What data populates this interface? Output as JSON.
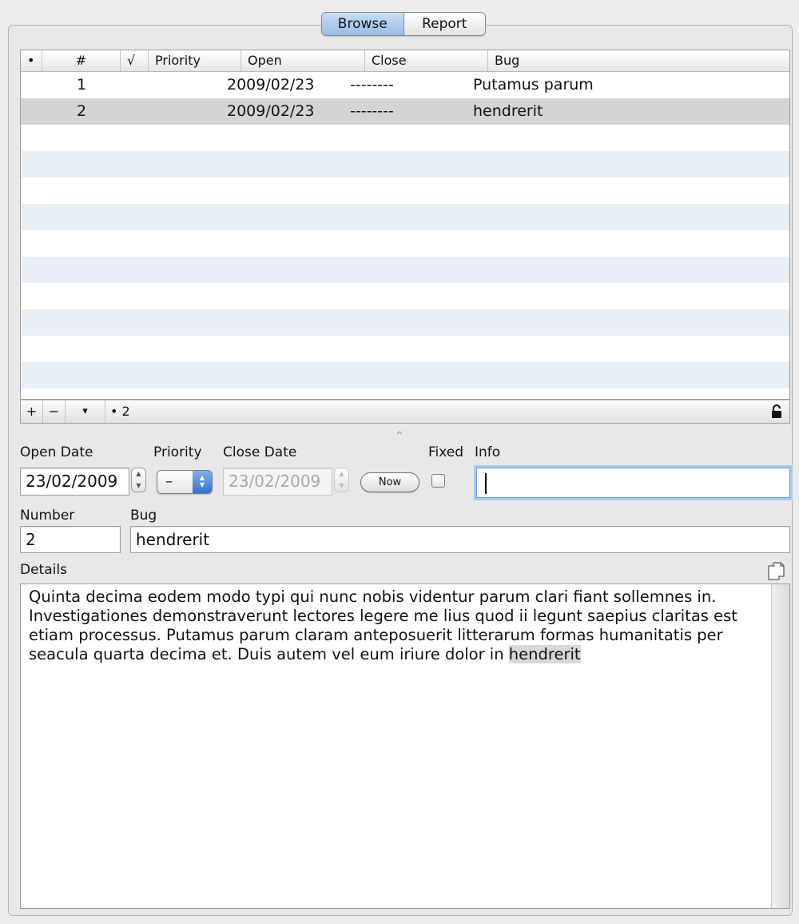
{
  "segments": [
    "Browse",
    "Report"
  ],
  "table": {
    "headers": [
      "•",
      "#",
      "√",
      "Priority",
      "Open",
      "Close",
      "Bug"
    ],
    "rows": [
      {
        "num": "1",
        "check": "",
        "priority": "",
        "open": "2009/02/23",
        "close": "--------",
        "bug": "Putamus parum"
      },
      {
        "num": "2",
        "check": "",
        "priority": "",
        "open": "2009/02/23",
        "close": "--------",
        "bug": "hendrerit"
      }
    ]
  },
  "footer": {
    "add": "+",
    "remove": "−",
    "menu": "▾",
    "count": "• 2"
  },
  "form": {
    "open_date_label": "Open Date",
    "open_date": "23/02/2009",
    "priority_label": "Priority",
    "priority_value": "–",
    "close_date_label": "Close Date",
    "close_date": "23/02/2009",
    "now_label": "Now",
    "fixed_label": "Fixed",
    "info_label": "Info",
    "info_value": "",
    "number_label": "Number",
    "number_value": "2",
    "bug_label": "Bug",
    "bug_value": "hendrerit",
    "details_label": "Details",
    "details_text": "Quinta decima eodem modo typi qui nunc nobis videntur parum clari fiant sollemnes in. Investigationes demonstraverunt lectores legere me lius quod ii legunt saepius claritas est etiam processus. Putamus parum claram anteposuerit litterarum formas humanitatis per seacula quarta decima et. Duis autem vel eum iriure dolor in ",
    "details_highlight": "hendrerit"
  },
  "colors": {
    "selection": "#d4d4d4",
    "stripe": "#e9eff8",
    "focus": "#a9c9f2"
  },
  "icons": {
    "lock": "lock-icon",
    "copy": "copy-icon",
    "splitter": "splitter-grip-icon"
  }
}
